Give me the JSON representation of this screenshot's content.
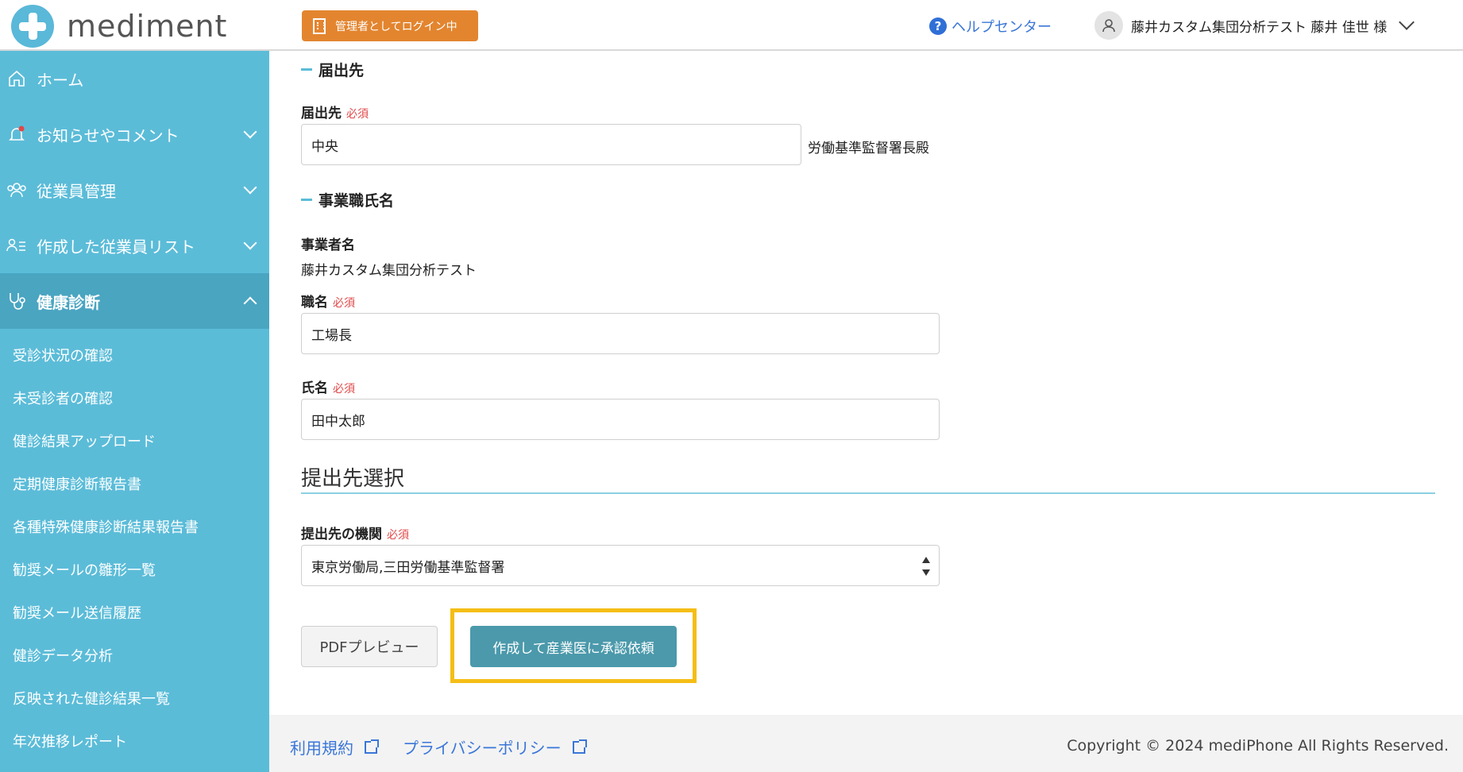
{
  "header": {
    "logo_text": "mediment",
    "admin_badge": "管理者としてログイン中",
    "help_label": "ヘルプセンター",
    "user_label": "藤井カスタム集団分析テスト 藤井 佳世 様"
  },
  "sidebar": {
    "items": [
      {
        "label": "ホーム",
        "icon": "home-icon"
      },
      {
        "label": "お知らせやコメント",
        "icon": "bell-icon"
      },
      {
        "label": "従業員管理",
        "icon": "users-icon"
      },
      {
        "label": "作成した従業員リスト",
        "icon": "user-list-icon"
      },
      {
        "label": "健康診断",
        "icon": "stethoscope-icon"
      }
    ],
    "sub_items": [
      "受診状況の確認",
      "未受診者の確認",
      "健診結果アップロード",
      "定期健康診断報告書",
      "各種特殊健康診断結果報告書",
      "勧奨メールの雛形一覧",
      "勧奨メール送信履歴",
      "健診データ分析",
      "反映された健診結果一覧",
      "年次推移レポート"
    ]
  },
  "form": {
    "section_destination": "届出先",
    "destination_label": "届出先",
    "required": "必須",
    "destination_value": "中央",
    "destination_suffix": "労働基準監督署長殿",
    "section_employer": "事業職氏名",
    "employer_label": "事業者名",
    "employer_value": "藤井カスタム集団分析テスト",
    "title_label": "職名",
    "title_value": "工場長",
    "name_label": "氏名",
    "name_value": "田中太郎",
    "submit_section_title": "提出先選択",
    "agency_label": "提出先の機関",
    "agency_value": "東京労働局,三田労働基準監督署",
    "pdf_button": "PDFプレビュー",
    "submit_button": "作成して産業医に承認依頼"
  },
  "footer": {
    "terms": "利用規約",
    "privacy": "プライバシーポリシー",
    "copyright": "Copyright © 2024 mediPhone All Rights Reserved."
  },
  "colors": {
    "sidebar_bg": "#5bbcd8",
    "sidebar_active": "#4aa5c1",
    "admin_badge": "#e3852f",
    "submit_button": "#4b99ab",
    "highlight": "#f5be16",
    "link": "#3a76d8",
    "required": "#e04848"
  }
}
